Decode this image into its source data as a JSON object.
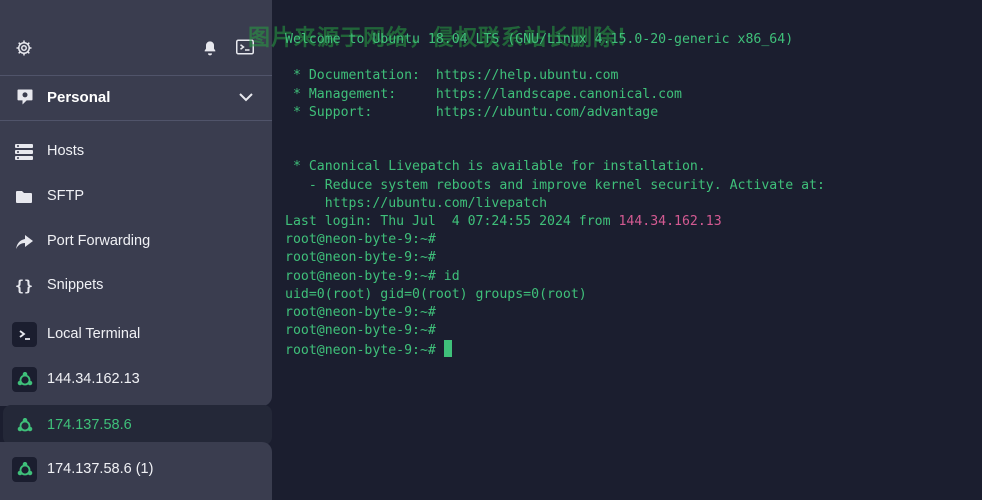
{
  "sidebar": {
    "vault": {
      "label": "Personal"
    },
    "nav": [
      {
        "label": "Hosts",
        "icon": "hosts-icon"
      },
      {
        "label": "SFTP",
        "icon": "folder-icon"
      },
      {
        "label": "Port Forwarding",
        "icon": "forward-arrow-icon"
      },
      {
        "label": "Snippets",
        "icon": "braces-icon"
      }
    ],
    "hosts": [
      {
        "label": "Local Terminal",
        "icon": "terminal-icon"
      },
      {
        "label": "144.34.162.13",
        "icon": "ubuntu-icon"
      },
      {
        "label": "174.137.58.6",
        "icon": "ubuntu-icon",
        "active": true
      },
      {
        "label": "174.137.58.6 (1)",
        "icon": "ubuntu-icon"
      }
    ]
  },
  "terminal": {
    "watermark": "图片来源于网络，侵权联系站长删除！",
    "welcome": "Welcome to Ubuntu 18.04 LTS (GNU/Linux 4.15.0-20-generic x86_64)",
    "doc_line": " * Documentation:  https://help.ubuntu.com",
    "mgmt_line": " * Management:     https://landscape.canonical.com",
    "support_line": " * Support:        https://ubuntu.com/advantage",
    "livepatch_1": " * Canonical Livepatch is available for installation.",
    "livepatch_2": "   - Reduce system reboots and improve kernel security. Activate at:",
    "livepatch_3": "     https://ubuntu.com/livepatch",
    "last_login_prefix": "Last login: Thu Jul  4 07:24:55 2024 from ",
    "last_login_ip": "144.34.162.13",
    "prompt_1": "root@neon-byte-9:~#",
    "prompt_2": "root@neon-byte-9:~#",
    "prompt_3": "root@neon-byte-9:~# id",
    "id_output": "uid=0(root) gid=0(root) groups=0(root)",
    "prompt_4": "root@neon-byte-9:~#",
    "prompt_5": "root@neon-byte-9:~#",
    "prompt_6": "root@neon-byte-9:~# "
  },
  "colors": {
    "terminal_bg": "#1b1e2f",
    "sidebar_bg": "#3a3d4f",
    "terminal_text": "#3fc07a",
    "ip_highlight": "#d45a92",
    "active_host": "#3fc07a"
  }
}
